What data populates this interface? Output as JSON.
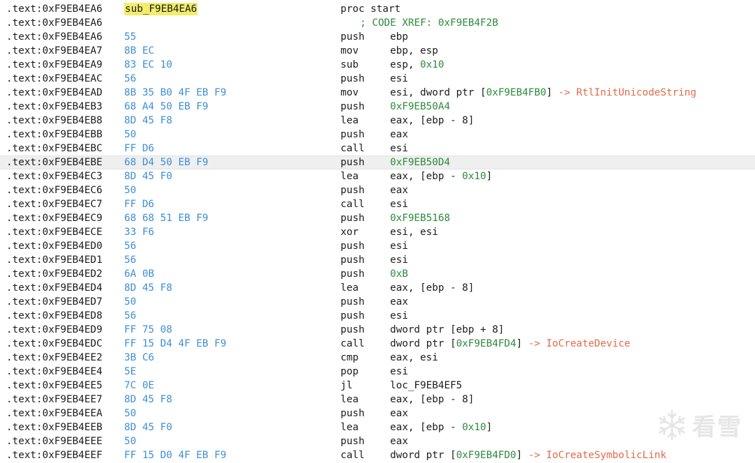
{
  "listing": {
    "rows": [
      {
        "addr": ".text:0xF9EB4EA6",
        "label": "sub_F9EB4EA6",
        "mnem": "proc start",
        "ops": []
      },
      {
        "addr": ".text:0xF9EB4EA6",
        "comment": [
          {
            "t": "; CODE XREF: 0xF9EB4F2B",
            "c": "xref"
          }
        ]
      },
      {
        "addr": ".text:0xF9EB4EA6",
        "bytes": "55",
        "mnem": "push",
        "ops": [
          {
            "t": "ebp"
          }
        ]
      },
      {
        "addr": ".text:0xF9EB4EA7",
        "bytes": "8B EC",
        "mnem": "mov",
        "ops": [
          {
            "t": "ebp, esp"
          }
        ]
      },
      {
        "addr": ".text:0xF9EB4EA9",
        "bytes": "83 EC 10",
        "mnem": "sub",
        "ops": [
          {
            "t": "esp, "
          },
          {
            "t": "0x10",
            "c": "n"
          }
        ]
      },
      {
        "addr": ".text:0xF9EB4EAC",
        "bytes": "56",
        "mnem": "push",
        "ops": [
          {
            "t": "esi"
          }
        ]
      },
      {
        "addr": ".text:0xF9EB4EAD",
        "bytes": "8B 35 B0 4F EB F9",
        "mnem": "mov",
        "ops": [
          {
            "t": "esi, dword ptr ["
          },
          {
            "t": "0xF9EB4FB0",
            "c": "n"
          },
          {
            "t": "] "
          },
          {
            "t": "-> RtlInitUnicodeString",
            "c": "arrow-api"
          }
        ]
      },
      {
        "addr": ".text:0xF9EB4EB3",
        "bytes": "68 A4 50 EB F9",
        "mnem": "push",
        "ops": [
          {
            "t": "0xF9EB50A4",
            "c": "n"
          }
        ]
      },
      {
        "addr": ".text:0xF9EB4EB8",
        "bytes": "8D 45 F8",
        "mnem": "lea",
        "ops": [
          {
            "t": "eax, [ebp - 8]"
          }
        ]
      },
      {
        "addr": ".text:0xF9EB4EBB",
        "bytes": "50",
        "mnem": "push",
        "ops": [
          {
            "t": "eax"
          }
        ]
      },
      {
        "addr": ".text:0xF9EB4EBC",
        "bytes": "FF D6",
        "mnem": "call",
        "ops": [
          {
            "t": "esi"
          }
        ]
      },
      {
        "addr": ".text:0xF9EB4EBE",
        "bytes": "68 D4 50 EB F9",
        "mnem": "push",
        "ops": [
          {
            "t": "0xF9EB50D4",
            "c": "n"
          }
        ],
        "highlight": true
      },
      {
        "addr": ".text:0xF9EB4EC3",
        "bytes": "8D 45 F0",
        "mnem": "lea",
        "ops": [
          {
            "t": "eax, [ebp - "
          },
          {
            "t": "0x10",
            "c": "n"
          },
          {
            "t": "]"
          }
        ]
      },
      {
        "addr": ".text:0xF9EB4EC6",
        "bytes": "50",
        "mnem": "push",
        "ops": [
          {
            "t": "eax"
          }
        ]
      },
      {
        "addr": ".text:0xF9EB4EC7",
        "bytes": "FF D6",
        "mnem": "call",
        "ops": [
          {
            "t": "esi"
          }
        ]
      },
      {
        "addr": ".text:0xF9EB4EC9",
        "bytes": "68 68 51 EB F9",
        "mnem": "push",
        "ops": [
          {
            "t": "0xF9EB5168",
            "c": "n"
          }
        ]
      },
      {
        "addr": ".text:0xF9EB4ECE",
        "bytes": "33 F6",
        "mnem": "xor",
        "ops": [
          {
            "t": "esi, esi"
          }
        ]
      },
      {
        "addr": ".text:0xF9EB4ED0",
        "bytes": "56",
        "mnem": "push",
        "ops": [
          {
            "t": "esi"
          }
        ]
      },
      {
        "addr": ".text:0xF9EB4ED1",
        "bytes": "56",
        "mnem": "push",
        "ops": [
          {
            "t": "esi"
          }
        ]
      },
      {
        "addr": ".text:0xF9EB4ED2",
        "bytes": "6A 0B",
        "mnem": "push",
        "ops": [
          {
            "t": "0xB",
            "c": "n"
          }
        ]
      },
      {
        "addr": ".text:0xF9EB4ED4",
        "bytes": "8D 45 F8",
        "mnem": "lea",
        "ops": [
          {
            "t": "eax, [ebp - 8]"
          }
        ]
      },
      {
        "addr": ".text:0xF9EB4ED7",
        "bytes": "50",
        "mnem": "push",
        "ops": [
          {
            "t": "eax"
          }
        ]
      },
      {
        "addr": ".text:0xF9EB4ED8",
        "bytes": "56",
        "mnem": "push",
        "ops": [
          {
            "t": "esi"
          }
        ]
      },
      {
        "addr": ".text:0xF9EB4ED9",
        "bytes": "FF 75 08",
        "mnem": "push",
        "ops": [
          {
            "t": "dword ptr [ebp + 8]"
          }
        ]
      },
      {
        "addr": ".text:0xF9EB4EDC",
        "bytes": "FF 15 D4 4F EB F9",
        "mnem": "call",
        "ops": [
          {
            "t": "dword ptr ["
          },
          {
            "t": "0xF9EB4FD4",
            "c": "n"
          },
          {
            "t": "] "
          },
          {
            "t": "-> IoCreateDevice",
            "c": "arrow-api"
          }
        ]
      },
      {
        "addr": ".text:0xF9EB4EE2",
        "bytes": "3B C6",
        "mnem": "cmp",
        "ops": [
          {
            "t": "eax, esi"
          }
        ]
      },
      {
        "addr": ".text:0xF9EB4EE4",
        "bytes": "5E",
        "mnem": "pop",
        "ops": [
          {
            "t": "esi"
          }
        ]
      },
      {
        "addr": ".text:0xF9EB4EE5",
        "bytes": "7C 0E",
        "mnem": "jl",
        "ops": [
          {
            "t": "loc_F9EB4EF5"
          }
        ]
      },
      {
        "addr": ".text:0xF9EB4EE7",
        "bytes": "8D 45 F8",
        "mnem": "lea",
        "ops": [
          {
            "t": "eax, [ebp - 8]"
          }
        ]
      },
      {
        "addr": ".text:0xF9EB4EEA",
        "bytes": "50",
        "mnem": "push",
        "ops": [
          {
            "t": "eax"
          }
        ]
      },
      {
        "addr": ".text:0xF9EB4EEB",
        "bytes": "8D 45 F0",
        "mnem": "lea",
        "ops": [
          {
            "t": "eax, [ebp - "
          },
          {
            "t": "0x10",
            "c": "n"
          },
          {
            "t": "]"
          }
        ]
      },
      {
        "addr": ".text:0xF9EB4EEE",
        "bytes": "50",
        "mnem": "push",
        "ops": [
          {
            "t": "eax"
          }
        ]
      },
      {
        "addr": ".text:0xF9EB4EEF",
        "bytes": "FF 15 D0 4F EB F9",
        "mnem": "call",
        "ops": [
          {
            "t": "dword ptr ["
          },
          {
            "t": "0xF9EB4FD0",
            "c": "n"
          },
          {
            "t": "] "
          },
          {
            "t": "-> IoCreateSymbolicLink",
            "c": "arrow-api"
          }
        ]
      }
    ]
  },
  "watermark": {
    "text": "看雪",
    "icon": "snowflake-icon"
  },
  "colors": {
    "address": "#1c1c1c",
    "bytes": "#3d8fd8",
    "number": "#2e8a3c",
    "api_ref": "#e06b4a",
    "label_highlight": "#f2ee6a",
    "row_highlight": "#efefef"
  }
}
